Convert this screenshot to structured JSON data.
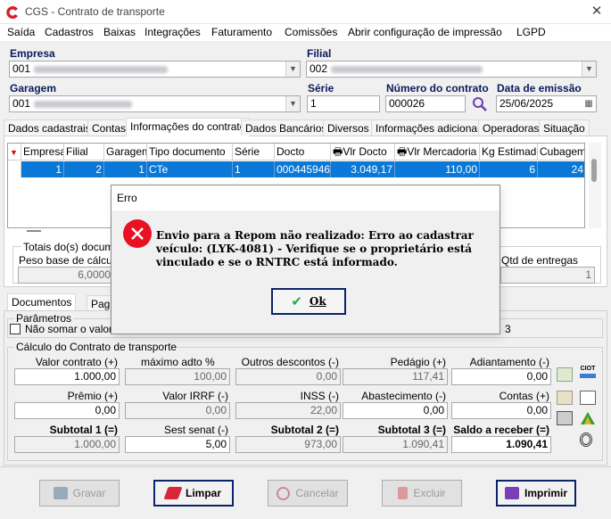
{
  "window": {
    "title": "CGS - Contrato de transporte"
  },
  "menu": [
    "Saída",
    "Cadastros",
    "Baixas",
    "Integrações",
    "Faturamento",
    "Comissões",
    "Abrir configuração de impressão",
    "LGPD"
  ],
  "header": {
    "empresa_label": "Empresa",
    "empresa_value": "001",
    "filial_label": "Filial",
    "filial_value": "002",
    "garagem_label": "Garagem",
    "garagem_value": "001",
    "serie_label": "Série",
    "serie_value": "1",
    "numero_label": "Número do contrato",
    "numero_value": "000026",
    "data_label": "Data de emissão",
    "data_value": "25/06/2025"
  },
  "tabs": [
    "Dados cadastrais",
    "Contas",
    "Informações do contrato",
    "Dados Bancários",
    "Diversos",
    "Informações adicionais",
    "Operadoras",
    "Situação"
  ],
  "grid": {
    "columns": [
      "Empresa",
      "Filial",
      "Garagem",
      "Tipo documento",
      "Série",
      "Docto",
      "Vlr Docto",
      "Vlr Mercadoria",
      "Kg Estimado",
      "Cubagem"
    ],
    "rows": [
      [
        "1",
        "2",
        "1",
        "CTe",
        "1",
        "000445946",
        "3.049,17",
        "110,00",
        "6",
        "24"
      ]
    ]
  },
  "totals": {
    "title": "Totais do(s) documen",
    "peso_label": "Peso base de cálculo",
    "peso_value": "6,0000",
    "qtd_label": "Qtd de entregas",
    "qtd_value": "1"
  },
  "lower_tabs": [
    "Documentos",
    "Paga"
  ],
  "params": {
    "title": "Parâmetros",
    "checkbox_label": "Não somar o valor do",
    "right_text": "3"
  },
  "calc": {
    "title": "Cálculo do Contrato de transporte",
    "row1": [
      {
        "label": "Valor contrato (+)",
        "value": "1.000,00",
        "ro": false
      },
      {
        "label": "máximo adto %",
        "value": "100,00",
        "ro": true
      },
      {
        "label": "Outros descontos (-)",
        "value": "0,00",
        "ro": true
      },
      {
        "label": "Pedágio (+)",
        "value": "117,41",
        "ro": true
      },
      {
        "label": "Adiantamento (-)",
        "value": "0,00",
        "ro": false
      }
    ],
    "row2": [
      {
        "label": "Prêmio (+)",
        "value": "0,00",
        "ro": false
      },
      {
        "label": "Valor IRRF (-)",
        "value": "0,00",
        "ro": true
      },
      {
        "label": "INSS (-)",
        "value": "22,00",
        "ro": true
      },
      {
        "label": "Abastecimento (-)",
        "value": "0,00",
        "ro": false
      },
      {
        "label": "Contas (+)",
        "value": "0,00",
        "ro": false
      }
    ],
    "row3": [
      {
        "label": "Subtotal 1 (=)",
        "value": "1.000,00",
        "ro": true
      },
      {
        "label": "Sest senat (-)",
        "value": "5,00",
        "ro": false
      },
      {
        "label": "Subtotal 2 (=)",
        "value": "973,00",
        "ro": true
      },
      {
        "label": "Subtotal 3 (=)",
        "value": "1.090,41",
        "ro": true
      },
      {
        "label": "Saldo a receber (=)",
        "value": "1.090,41",
        "ro": false
      }
    ],
    "side_icon_text": "CIOT"
  },
  "buttons": {
    "gravar": "Gravar",
    "limpar": "Limpar",
    "cancelar": "Cancelar",
    "excluir": "Excluir",
    "imprimir": "Imprimir"
  },
  "dialog": {
    "title": "Erro",
    "message": "Envio para a Repom não realizado: Erro ao cadastrar veículo: (LYK-4081) - Verifique se o proprietário está vinculado e se o RNTRC está informado.",
    "ok_label": "Ok"
  },
  "colors": {
    "selection": "#0a78d7",
    "error": "#e81123",
    "header_label": "#0a1a5a"
  }
}
